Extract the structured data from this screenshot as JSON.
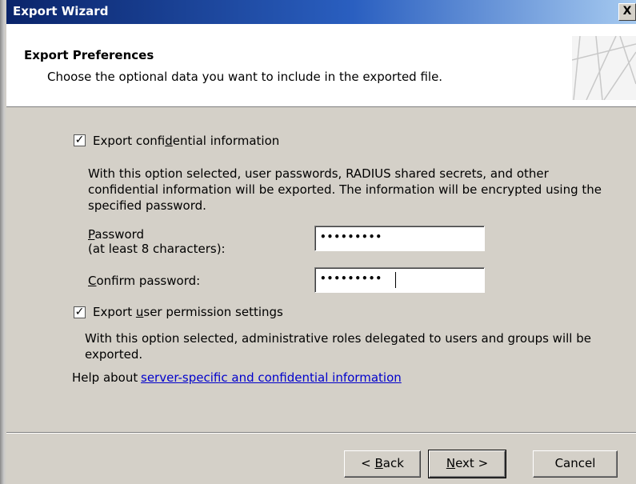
{
  "window": {
    "title": "Export Wizard",
    "close_glyph": "X"
  },
  "header": {
    "title": "Export Preferences",
    "subtitle": "Choose the optional data you want to include in the exported file."
  },
  "confidential": {
    "checked": true,
    "label_pre": "Export confi",
    "label_accel": "d",
    "label_post": "ential information",
    "description": "With this option selected, user passwords, RADIUS shared secrets, and other confidential information will be exported. The information will be encrypted using the specified password."
  },
  "password": {
    "label_accel": "P",
    "label_rest": "assword",
    "label_line2": "(at least 8 characters):",
    "value_mask": "•••••••••"
  },
  "confirm_password": {
    "label_accel": "C",
    "label_rest": "onfirm password:",
    "value_mask": "•••••••••"
  },
  "permissions": {
    "checked": true,
    "label_pre": "Export ",
    "label_accel": "u",
    "label_post": "ser permission settings",
    "description": "With this option selected, administrative roles delegated to users and groups will be exported."
  },
  "help": {
    "prefix": "Help about ",
    "link_text": "server-specific and confidential information"
  },
  "buttons": {
    "back": {
      "pre": "< ",
      "accel": "B",
      "post": "ack"
    },
    "next": {
      "accel": "N",
      "post": "ext >"
    },
    "cancel": "Cancel"
  }
}
